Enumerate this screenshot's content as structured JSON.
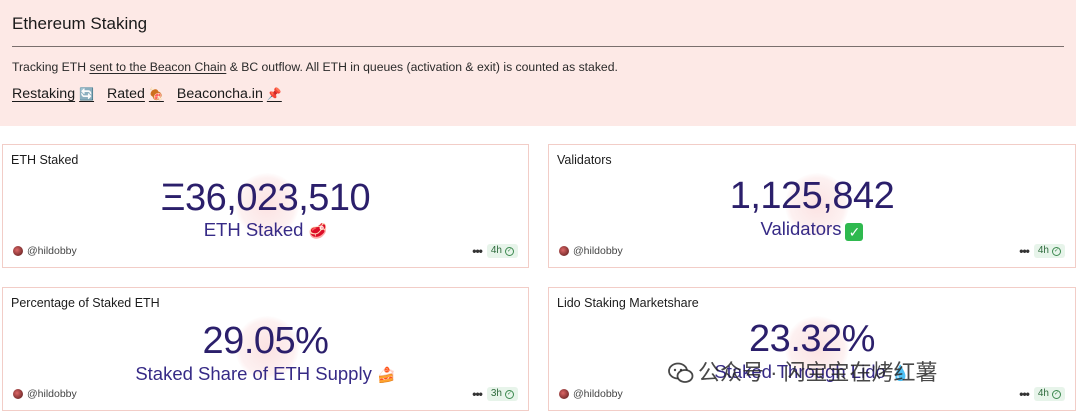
{
  "header": {
    "title": "Ethereum Staking",
    "desc_before": "Tracking ETH ",
    "desc_link": "sent to the Beacon Chain",
    "desc_after": " & BC outflow. All ETH in queues (activation & exit) is counted as staked.",
    "links": [
      {
        "label": "Restaking",
        "emoji": "🔄"
      },
      {
        "label": "Rated",
        "emoji": "🍖"
      },
      {
        "label": "Beaconcha.in",
        "emoji": "📌"
      }
    ]
  },
  "cards": [
    {
      "title": "ETH Staked",
      "value": "Ξ36,023,510",
      "subtitle": "ETH Staked",
      "emoji": "🥩",
      "author": "@hildobby",
      "age": "4h"
    },
    {
      "title": "Validators",
      "value": "1,125,842",
      "subtitle": "Validators",
      "emoji": "✓",
      "author": "@hildobby",
      "age": "4h"
    },
    {
      "title": "Percentage of Staked ETH",
      "value": "29.05%",
      "subtitle": "Staked Share of ETH Supply",
      "emoji": "🍰",
      "author": "@hildobby",
      "age": "3h"
    },
    {
      "title": "Lido Staking Marketshare",
      "value": "23.32%",
      "subtitle": "Staked Through Lido",
      "emoji": "💧",
      "author": "@hildobby",
      "age": "4h"
    }
  ],
  "watermark": "公众号 · 闪宝宝在烤红薯",
  "colors": {
    "header_bg": "#fde9e6",
    "metric": "#2b1f6b",
    "badge_bg": "#e7f4ea",
    "card_border": "#f2cdc7"
  }
}
